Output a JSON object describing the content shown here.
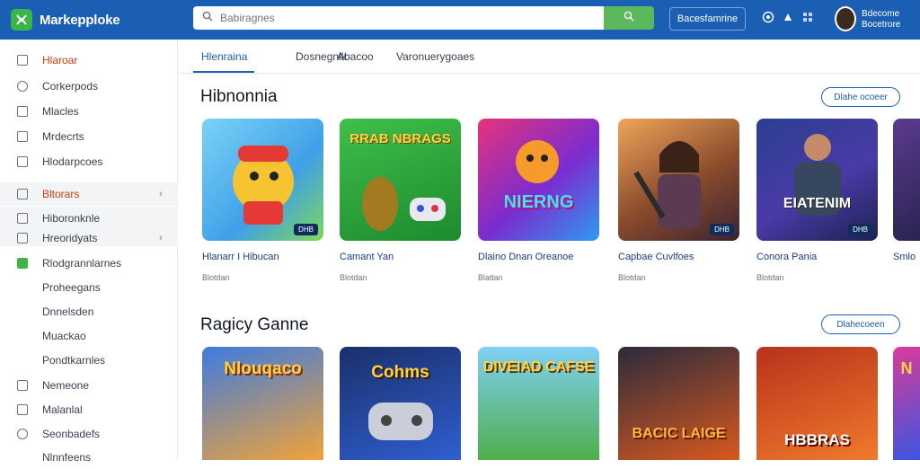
{
  "header": {
    "app_name": "Markepploke",
    "search_placeholder": "Babiragnes",
    "action_button": "Bacesfamrine",
    "user_name": "Bdecome",
    "user_sub": "Bocetrore"
  },
  "sidebar": {
    "items": [
      {
        "label": "Hlaroar"
      },
      {
        "label": "Corkerpods"
      },
      {
        "label": "Mlacles"
      },
      {
        "label": "Mrdecrts"
      },
      {
        "label": "Hlodarpcoes"
      },
      {
        "label": "Bltorars"
      },
      {
        "label": "Hiboronknle"
      },
      {
        "label": "Hreoridyats"
      },
      {
        "label": "Rlodgrannlarnes"
      },
      {
        "label": "Proheegans"
      },
      {
        "label": "Dnnelsden"
      },
      {
        "label": "Muackao"
      },
      {
        "label": "Pondtkarnles"
      },
      {
        "label": "Nemeone"
      },
      {
        "label": "Malanlal"
      },
      {
        "label": "Seonbadefs"
      },
      {
        "label": "Nlnnfeens"
      }
    ]
  },
  "tabs": [
    "Hlenraina",
    "Dosnegnlk",
    "Abacoo",
    "Varonuerygoaes"
  ],
  "sections": [
    {
      "title": "Hibnonnia",
      "button": "Dlahe ocoeer",
      "games": [
        {
          "title": "Hlanarr I Hibucan",
          "sub": "Blotdan",
          "badge": "DHB",
          "art": ""
        },
        {
          "title": "Camant Yan",
          "sub": "Blotdan",
          "badge": "",
          "art": "RRAB NBRAGS"
        },
        {
          "title": "Dlaino Dnan Oreanoe",
          "sub": "Blatlan",
          "badge": "",
          "art": "NIERNG"
        },
        {
          "title": "Capbae Cuvlfoes",
          "sub": "Blotdan",
          "badge": "DHB",
          "art": ""
        },
        {
          "title": "Conora Pania",
          "sub": "Blotdan",
          "badge": "DHB",
          "art": "EIATENIM"
        },
        {
          "title": "Smlo",
          "sub": "",
          "badge": "",
          "art": ""
        }
      ]
    },
    {
      "title": "Ragicy Ganne",
      "button": "Dlahecoeen",
      "games": [
        {
          "art": "Nlouqaco"
        },
        {
          "art": "Cohms"
        },
        {
          "art": "DIVEIAD CAFSE"
        },
        {
          "art": "BACIC LAIGE"
        },
        {
          "art": "HBBRAS"
        },
        {
          "art": "N"
        }
      ]
    }
  ]
}
